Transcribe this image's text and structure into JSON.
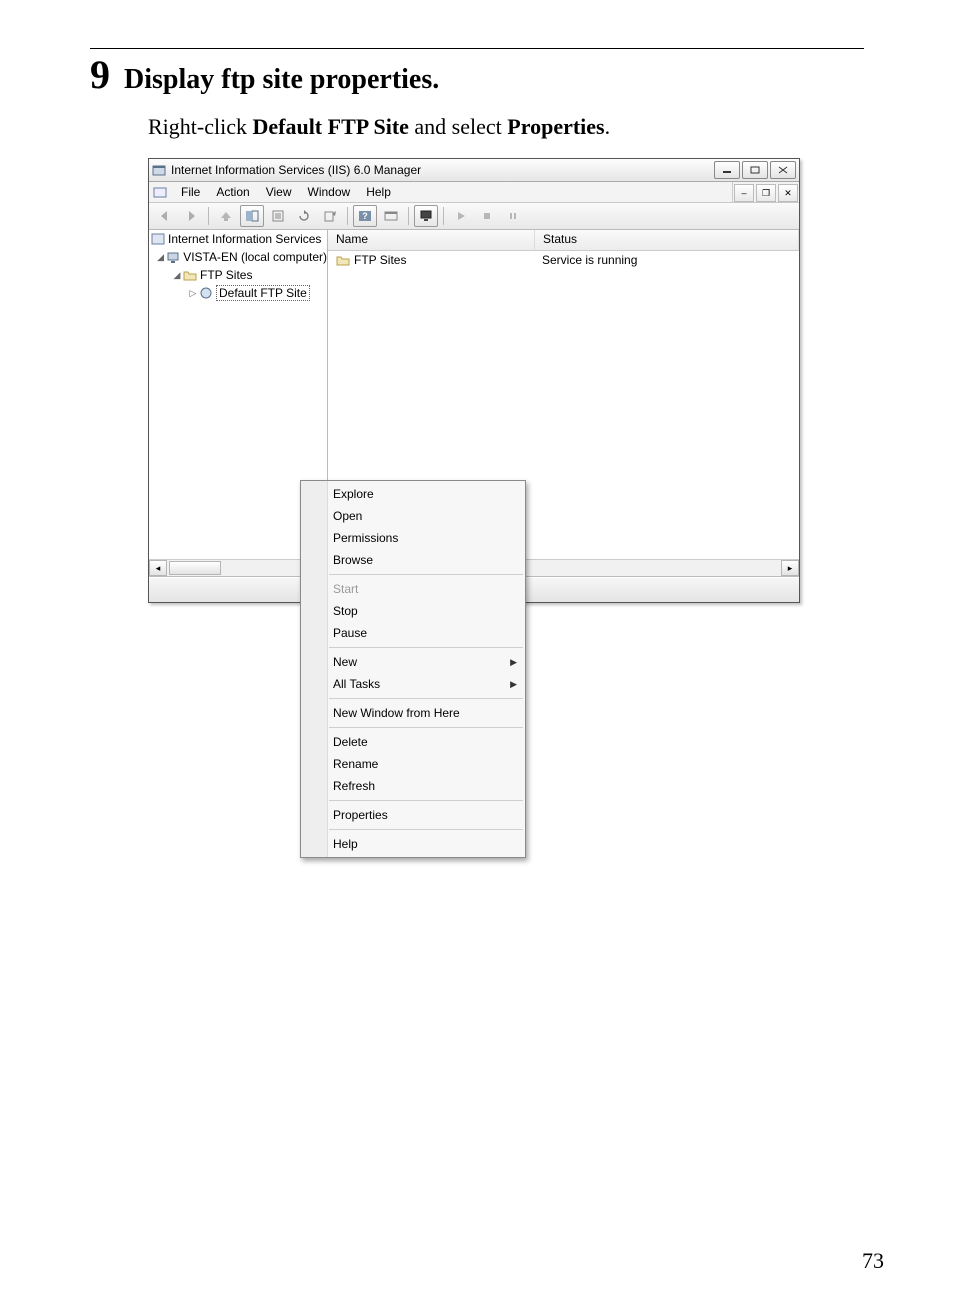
{
  "page_number": "73",
  "step": {
    "num": "9",
    "title": "Display ftp site properties."
  },
  "instruction_prefix": "Right-click ",
  "instruction_bold1": "Default FTP Site",
  "instruction_mid": " and select ",
  "instruction_bold2": "Properties",
  "instruction_suffix": ".",
  "window": {
    "title": "Internet Information Services (IIS) 6.0 Manager",
    "menus": [
      "File",
      "Action",
      "View",
      "Window",
      "Help"
    ],
    "tree": {
      "root": "Internet Information Services",
      "computer": "VISTA-EN (local computer)",
      "sites_node": "FTP Sites",
      "selected_site": "Default FTP Site"
    },
    "list": {
      "col_name": "Name",
      "col_status": "Status",
      "row_name": "FTP Sites",
      "row_status": "Service is running"
    }
  },
  "context_menu": {
    "items_g1": [
      "Explore",
      "Open",
      "Permissions",
      "Browse"
    ],
    "item_disabled": "Start",
    "items_g2": [
      "Stop",
      "Pause"
    ],
    "items_sub": [
      "New",
      "All Tasks"
    ],
    "item_newwin": "New Window from Here",
    "items_g3": [
      "Delete",
      "Rename",
      "Refresh"
    ],
    "item_props": "Properties",
    "item_help": "Help"
  }
}
